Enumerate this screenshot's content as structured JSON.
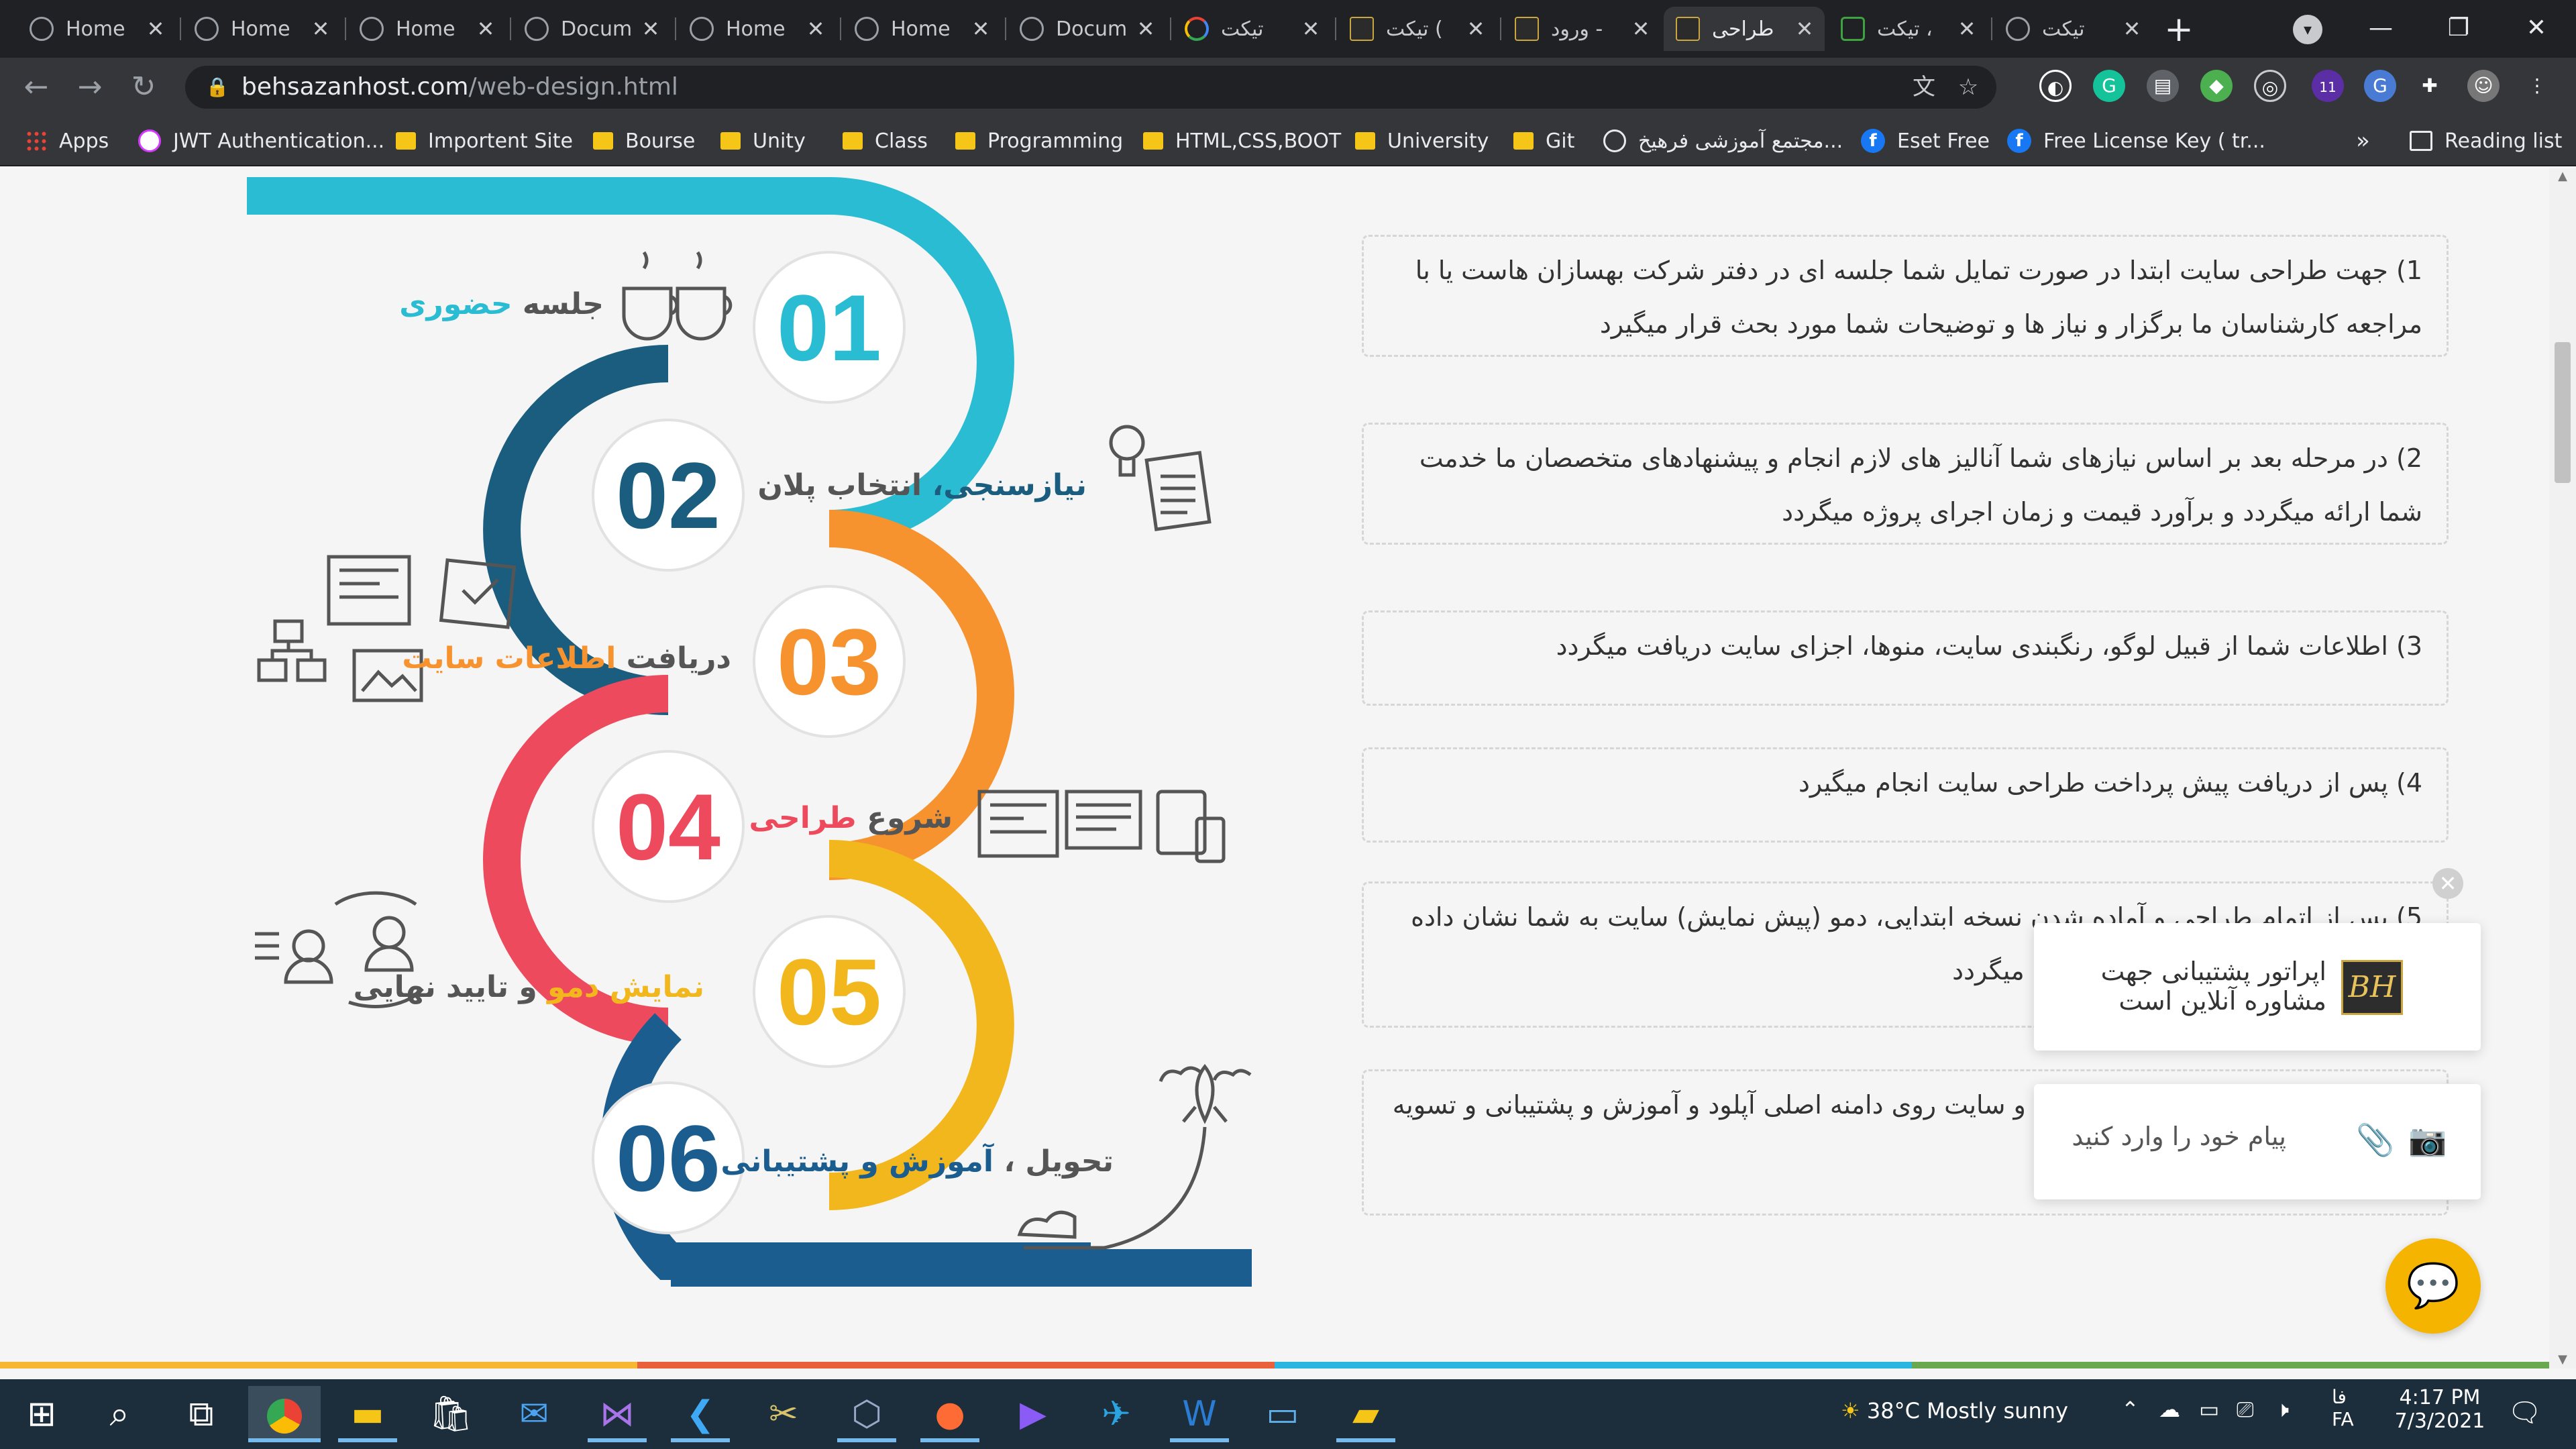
{
  "tabs": [
    {
      "label": "Home",
      "icon": "globe-icon"
    },
    {
      "label": "Home",
      "icon": "globe-icon"
    },
    {
      "label": "Home",
      "icon": "globe-icon"
    },
    {
      "label": "Docum",
      "icon": "globe-icon"
    },
    {
      "label": "Home",
      "icon": "globe-icon"
    },
    {
      "label": "Home",
      "icon": "globe-icon"
    },
    {
      "label": "Docum",
      "icon": "globe-icon"
    },
    {
      "label": "تیکت",
      "icon": "google-icon"
    },
    {
      "label": "تیکت (",
      "icon": "behsazan-icon"
    },
    {
      "label": "ورود -",
      "icon": "behsazan-icon"
    },
    {
      "label": "طراحی",
      "icon": "behsazan-icon",
      "active": true
    },
    {
      "label": "تیکت ،",
      "icon": "chat-icon"
    },
    {
      "label": "تیکت",
      "icon": "globe-icon"
    }
  ],
  "new_tab_label": "+",
  "window": {
    "minimize": "—",
    "restore": "❐",
    "close": "✕"
  },
  "address": {
    "domain": "behsazanhost.com",
    "path": "/web-design.html"
  },
  "extensions_badge": "11",
  "bookmarks": [
    {
      "label": "Apps",
      "icon": "apps-icon"
    },
    {
      "label": "JWT Authentication...",
      "icon": "jwt-icon"
    },
    {
      "label": "Importent Site",
      "icon": "folder-icon"
    },
    {
      "label": "Bourse",
      "icon": "folder-icon"
    },
    {
      "label": "Unity",
      "icon": "folder-icon"
    },
    {
      "label": "Class",
      "icon": "folder-icon"
    },
    {
      "label": "Programming",
      "icon": "folder-icon"
    },
    {
      "label": "HTML,CSS,BOOT",
      "icon": "folder-icon"
    },
    {
      "label": "University",
      "icon": "folder-icon"
    },
    {
      "label": "Git",
      "icon": "folder-icon"
    },
    {
      "label": "مجتمع آموزشی فرهیخ...",
      "icon": "globe-icon"
    },
    {
      "label": "Eset Free",
      "icon": "facebook-icon"
    },
    {
      "label": "Free License Key ( tr...",
      "icon": "facebook-icon"
    }
  ],
  "bookmarks_more": "»",
  "reading_list": "Reading list",
  "infographic": {
    "steps": [
      {
        "num": "01",
        "label_dark": "جلسه",
        "label_hl": "حضوری",
        "color": "#29bcd2"
      },
      {
        "num": "02",
        "label_dark": "انتخاب پلان",
        "label_hl": "نیازسنجی،",
        "color": "#1a5d7e"
      },
      {
        "num": "03",
        "label_dark": "دریافت",
        "label_hl": "اطلاعات سایت",
        "color": "#f7932f"
      },
      {
        "num": "04",
        "label_dark": "شروع",
        "label_hl": "طراحی",
        "color": "#ee4a5d"
      },
      {
        "num": "05",
        "label_dark": "و تایید نهایی",
        "label_hl": "نمایش دمو",
        "color": "#f3b71e"
      },
      {
        "num": "06",
        "label_dark": "تحویل ،",
        "label_hl": "آموزش و پشتیبانی",
        "color": "#1a5d8e"
      }
    ]
  },
  "steps_text": [
    "1) جهت طراحی سایت ابتدا در صورت تمایل شما جلسه ای در دفتر شرکت بهسازان هاست یا با مراجعه کارشناسان ما برگزار و نیاز ها و توضیحات شما مورد بحث قرار میگیرد",
    "2) در مرحله بعد بر اساس نیازهای شما آنالیز های لازم انجام و پیشنهادهای متخصصان ما خدمت شما ارائه میگردد و برآورد قیمت و زمان اجرای پروژه میگردد",
    "3) اطلاعات شما از قبیل لوگو، رنگبندی سایت، منوها، اجزای سایت دریافت میگردد",
    "4) پس از دریافت پیش پرداخت طراحی سایت انجام میگیرد",
    "5) پس از اتمام طراحی و آماده شدن نسخه ابتدایی، دمو (پیش نمایش) سایت به شما نشان داده میشود و تغییرات مورد نظر شما اجرا میگردد",
    "6) تحویل نهایی سایت انجام می گیرد و سایت روی دامنه اصلی آپلود و آموزش و پشتیبانی و تسویه نهایی انجام میگیرد"
  ],
  "chat": {
    "close": "✕",
    "operator_text": "اپراتور پشتیبانی جهت مشاوره آنلاین است",
    "logo_text": "BH",
    "input_placeholder": "پیام خود را وارد کنید"
  },
  "strip_colors": [
    "#f7b733",
    "#e8613a",
    "#2db5e2",
    "#6aa84f"
  ],
  "taskbar": {
    "weather": "38°C  Mostly sunny",
    "lang_top": "فا",
    "lang_bottom": "FA",
    "time": "4:17 PM",
    "date": "7/3/2021"
  }
}
